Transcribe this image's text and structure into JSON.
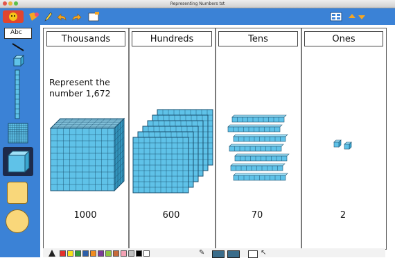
{
  "window": {
    "title": "Representing Numbers tst"
  },
  "canvas": {
    "columns": [
      {
        "header": "Thousands",
        "value": "1000"
      },
      {
        "header": "Hundreds",
        "value": "600"
      },
      {
        "header": "Tens",
        "value": "70"
      },
      {
        "header": "Ones",
        "value": "2"
      }
    ],
    "prompt_line1": "Represent the",
    "prompt_line2": "number 1,672"
  },
  "toolbar": {
    "icons": [
      "app-logo-icon",
      "shapes-icon",
      "pencil-icon",
      "undo-icon",
      "redo-icon",
      "new-page-icon",
      "page-layout-icon",
      "navigate-arrows-icon"
    ]
  },
  "sidebar": {
    "label_tool": "Abc",
    "tools": [
      "text-label-tool",
      "line-tool",
      "unit-cube-tool",
      "ten-rod-tool",
      "hundred-flat-tool",
      "thousand-cube-tool",
      "rectangle-tool",
      "circle-tool"
    ]
  },
  "palette": {
    "colors": [
      "#e4312b",
      "#f7e11b",
      "#2f9a3b",
      "#2c5ea8",
      "#f08b1f",
      "#7d3c98",
      "#8cc63f",
      "#c76a3a",
      "#f4a3b5",
      "#c0c0c0",
      "#000000",
      "#ffffff"
    ]
  },
  "colors": {
    "accent": "#3b82d6",
    "block_fill": "#5fc2e8",
    "block_line": "#1a4f6e"
  }
}
